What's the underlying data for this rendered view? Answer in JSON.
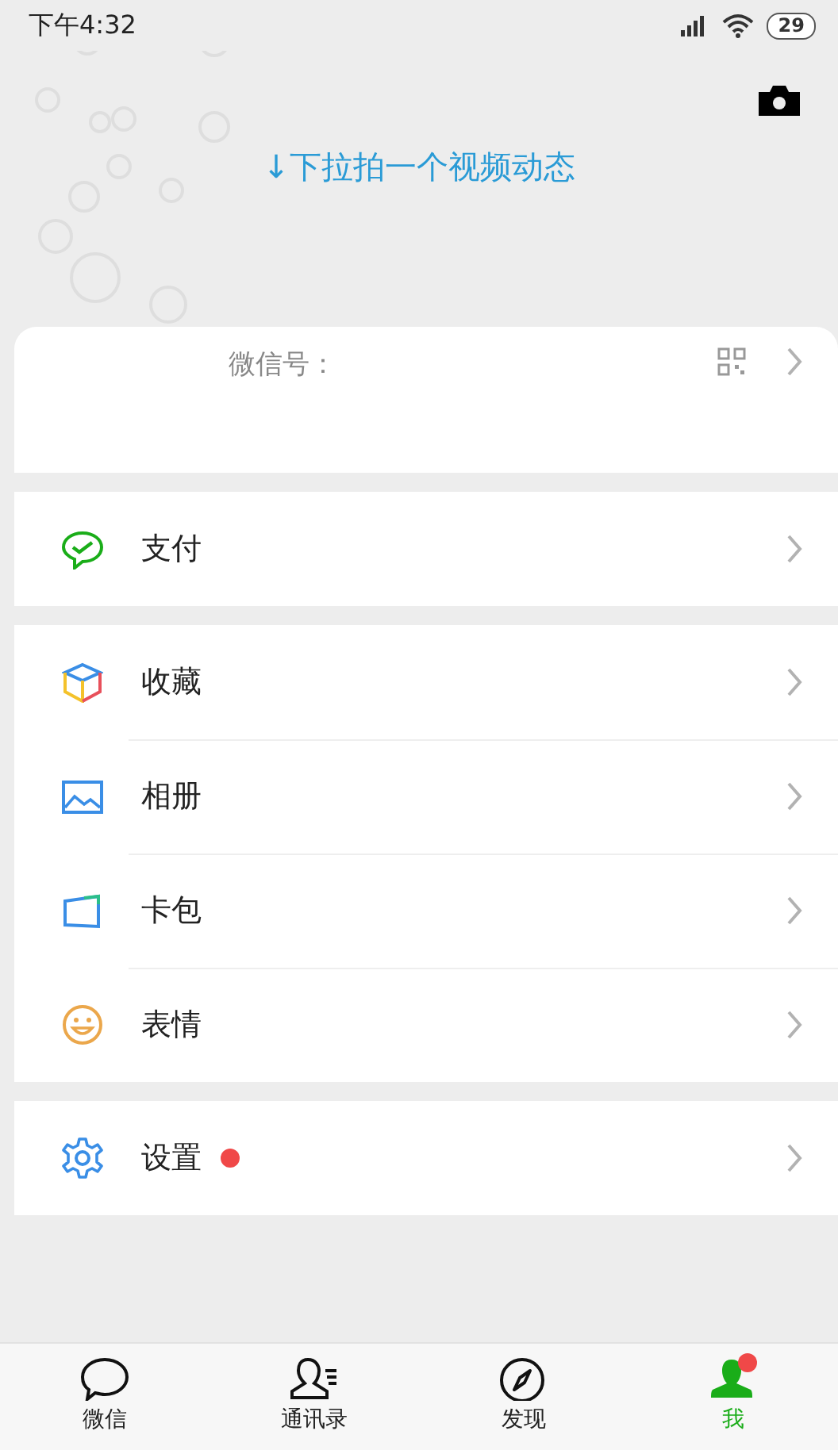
{
  "status_bar": {
    "time": "下午4:32",
    "battery": "29"
  },
  "header": {
    "pull_hint": "↓下拉拍一个视频动态"
  },
  "profile": {
    "wechat_id_label": "微信号："
  },
  "menu_groups": [
    [
      {
        "kind": "pay",
        "label": "支付",
        "badge": false
      }
    ],
    [
      {
        "kind": "favorites",
        "label": "收藏",
        "badge": false
      },
      {
        "kind": "album",
        "label": "相册",
        "badge": false
      },
      {
        "kind": "cards",
        "label": "卡包",
        "badge": false
      },
      {
        "kind": "stickers",
        "label": "表情",
        "badge": false
      }
    ],
    [
      {
        "kind": "settings",
        "label": "设置",
        "badge": true
      }
    ]
  ],
  "tabs": [
    {
      "kind": "chats",
      "label": "微信",
      "selected": false,
      "badge": false
    },
    {
      "kind": "contacts",
      "label": "通讯录",
      "selected": false,
      "badge": false
    },
    {
      "kind": "discover",
      "label": "发现",
      "selected": false,
      "badge": false
    },
    {
      "kind": "me",
      "label": "我",
      "selected": true,
      "badge": true
    }
  ]
}
